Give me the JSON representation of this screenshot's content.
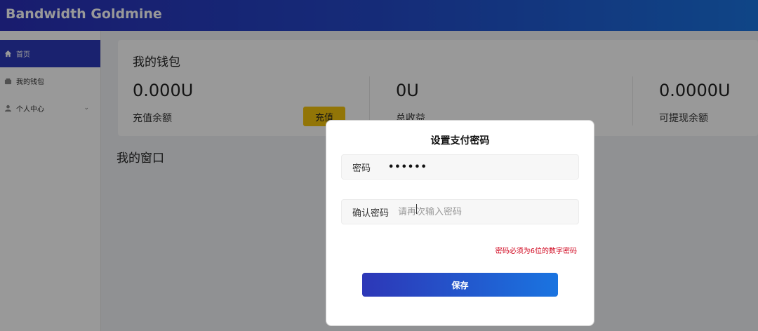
{
  "header": {
    "brand": "Bandwidth Goldmine"
  },
  "sidebar": {
    "items": [
      {
        "label": "首页",
        "icon": "home-icon",
        "active": true
      },
      {
        "label": "我的钱包",
        "icon": "wallet-icon",
        "active": false
      },
      {
        "label": "个人中心",
        "icon": "user-icon",
        "active": false,
        "expandable": true
      }
    ]
  },
  "wallet": {
    "title": "我的钱包",
    "stats": [
      {
        "value": "0.000U",
        "label": "充值余额"
      },
      {
        "value": "0U",
        "label": "总收益"
      },
      {
        "value": "0.0000U",
        "label": "可提现余额"
      }
    ],
    "recharge_label": "充值"
  },
  "window_title": "我的窗口",
  "modal": {
    "title": "设置支付密码",
    "password_label": "密码",
    "password_value": "••••••",
    "confirm_label": "确认密码",
    "confirm_placeholder": "请再次输入密码",
    "error_text": "密码必须为6位的数字密码",
    "save_label": "保存"
  },
  "colors": {
    "accent": "#2c39b9",
    "header_gradient_start": "#2a2fb8",
    "header_gradient_end": "#1a74e0",
    "recharge_button": "#f3c30d",
    "error": "#d0021b"
  }
}
